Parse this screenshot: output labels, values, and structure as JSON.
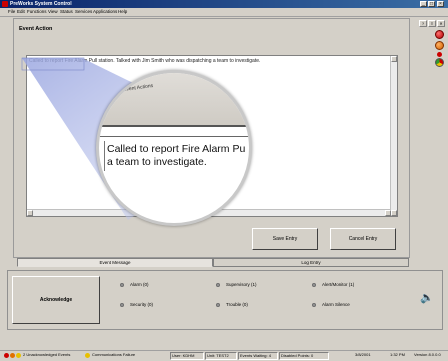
{
  "window": {
    "title": "PreWorks System Control"
  },
  "menu": [
    "File",
    "Edit",
    "Functions",
    "View",
    "Status",
    "Services",
    "Applications",
    "Help"
  ],
  "titlebar_buttons": [
    "_",
    "□",
    "×"
  ],
  "panel": {
    "title": "Event Action"
  },
  "memo": {
    "text": "Called to report Fire Alarm Pull station.  Talked with Jim Smith who was dispatching a team to investigate."
  },
  "magnifier": {
    "band_label": "Event Actions",
    "line1": "Called to report Fire Alarm Pu",
    "line2": "a team to investigate."
  },
  "buttons": {
    "save": "Save Entry",
    "cancel": "Cancel Entry",
    "acknowledge": "Acknowledge"
  },
  "tabs": {
    "event_message": "Event Message",
    "log_entry": "Log Entry"
  },
  "indicators": [
    {
      "label": "Alarm (0)"
    },
    {
      "label": "Supervisory (1)"
    },
    {
      "label": "Alert/Monitor (1)"
    },
    {
      "label": "Security (0)"
    },
    {
      "label": "Trouble (0)"
    },
    {
      "label": "Alarm Silence"
    }
  ],
  "rightbar": {
    "top_buttons": [
      "?",
      "≡",
      "✕"
    ]
  },
  "status": {
    "left_items": [
      "2 Unacknowledged Events",
      "Communications Failure"
    ],
    "user": "User: KDHM",
    "unit": "Unit: TEST2",
    "events": "Events Waiting: 4",
    "disabled": "Disabled Points: 0",
    "date": "3/8/2001",
    "time": "1:32 PM",
    "version": "Version 8.0.0.0"
  },
  "colors": {
    "title_start": "#0a246a",
    "title_end": "#3a6ea5",
    "alarm_red": "#cc0000",
    "warning_orange": "#e07000",
    "ok_green": "#2e9a2e",
    "comm_yellow": "#e8c000"
  }
}
